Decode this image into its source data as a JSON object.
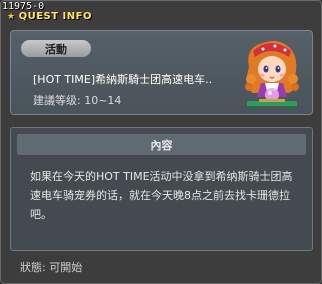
{
  "window": {
    "quest_id": "11975-0",
    "title": "QUEST INFO"
  },
  "event": {
    "badge_label": "活動",
    "title": "[HOT TIME]希納斯騎士团高速电车..",
    "level": "建議等级: 10~14"
  },
  "description": {
    "header": "內容",
    "text": "如果在今天的HOT TIME活动中没拿到希纳斯骑士团高速电车骑宠券的话，就在今天晚8点之前去找卡珊德拉吧。"
  },
  "status": {
    "text": "狀態: 可開始"
  },
  "colors": {
    "title_yellow": "#ffe36a",
    "card_bg": "#4f585f",
    "desc_bg": "#444a4f",
    "window_bg": "#3d3d3d"
  },
  "icons": {
    "title_icon": "star-icon",
    "npc": "npc-portrait-icon"
  }
}
